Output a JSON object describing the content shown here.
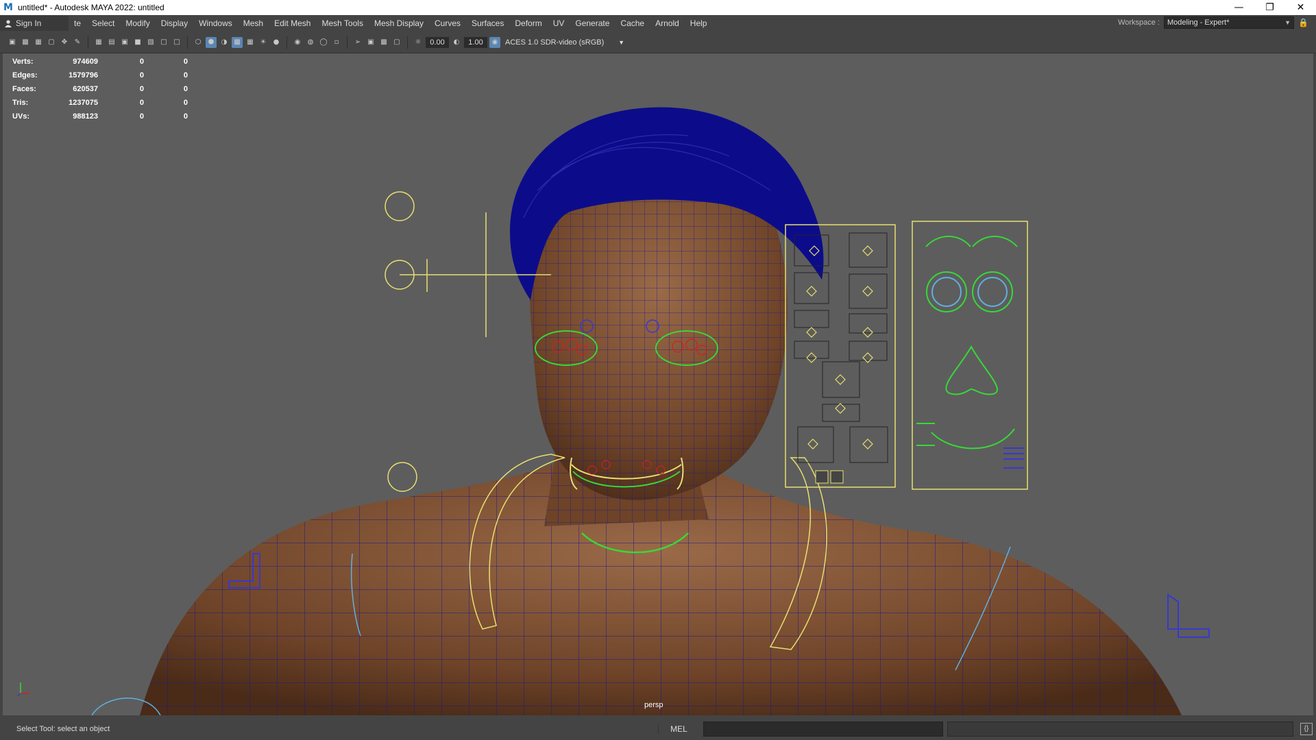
{
  "window": {
    "title": "untitled* - Autodesk MAYA 2022: untitled",
    "app_icon": "M",
    "controls": [
      "minimize-icon",
      "restore-icon",
      "close-icon"
    ]
  },
  "menubar": {
    "sign_in": "Sign In",
    "items": [
      "te",
      "Select",
      "Modify",
      "Display",
      "Windows",
      "Mesh",
      "Edit Mesh",
      "Mesh Tools",
      "Mesh Display",
      "Curves",
      "Surfaces",
      "Deform",
      "UV",
      "Generate",
      "Cache",
      "Arnold",
      "Help"
    ],
    "workspace_label": "Workspace :",
    "workspace_value": "Modeling - Expert*"
  },
  "panel_toolbar": {
    "exposure": "0.00",
    "gamma": "1.00",
    "color_space": "ACES 1.0 SDR-video (sRGB)"
  },
  "hud": {
    "rows": [
      {
        "label": "Verts:",
        "v1": "974609",
        "v2": "0",
        "v3": "0"
      },
      {
        "label": "Edges:",
        "v1": "1579796",
        "v2": "0",
        "v3": "0"
      },
      {
        "label": "Faces:",
        "v1": "620537",
        "v2": "0",
        "v3": "0"
      },
      {
        "label": "Tris:",
        "v1": "1237075",
        "v2": "0",
        "v3": "0"
      },
      {
        "label": "UVs:",
        "v1": "988123",
        "v2": "0",
        "v3": "0"
      }
    ]
  },
  "viewport": {
    "camera": "persp",
    "colors": {
      "background": "#5d5d5d",
      "skin": "#7a4a2e",
      "wire": "#1a1a8c",
      "hair": "#0c0c8a",
      "control_yellow": "#e8e070",
      "control_green": "#38d838",
      "control_blue": "#3838d0",
      "control_red": "#d02020",
      "control_cyan": "#60b0e0"
    }
  },
  "bottombar": {
    "help_line": "Select Tool: select an object",
    "mel_label": "MEL"
  }
}
